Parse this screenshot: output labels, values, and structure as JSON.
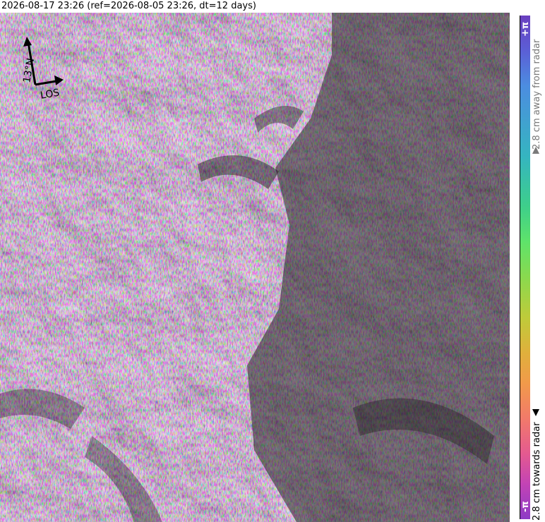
{
  "header": {
    "title": "2026-08-17 23:26 (ref=2026-08-05 23:26, dt=12 days)"
  },
  "compass": {
    "north_label": "13°N",
    "los_label": "LOS"
  },
  "colorbar": {
    "top_label": "+π",
    "bottom_label": "-π",
    "away_label": "2.8 cm away from radar",
    "towards_label": "2.8 cm towards radar"
  },
  "colors": {
    "away_text": "#7a7a7a",
    "towards_text": "#000000"
  },
  "icons": {
    "north_arrow": "arrow-up-icon",
    "los_arrow": "arrow-right-icon"
  }
}
